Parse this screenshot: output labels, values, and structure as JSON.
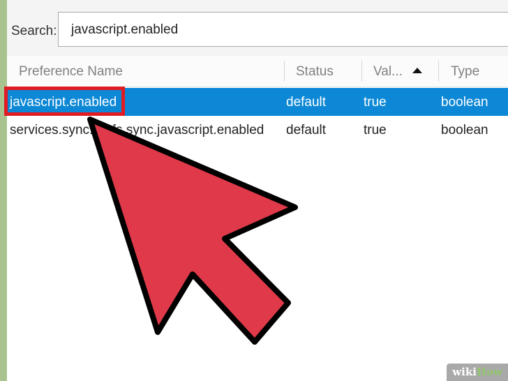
{
  "search": {
    "label": "Search:",
    "value": "javascript.enabled"
  },
  "table": {
    "columns": {
      "name": "Preference Name",
      "status": "Status",
      "value": "Val...",
      "type": "Type"
    },
    "rows": [
      {
        "name": "javascript.enabled",
        "status": "default",
        "value": "true",
        "type": "boolean"
      },
      {
        "name": "services.sync.prefs.sync.javascript.enabled",
        "status": "default",
        "value": "true",
        "type": "boolean"
      }
    ]
  },
  "annotation": {
    "arrow_color": "#e03a4a",
    "box_color": "#e01b24"
  },
  "watermark": {
    "prefix": "wiki",
    "suffix": "How"
  },
  "colors": {
    "selection": "#0d88d6",
    "background": "#a9c38f"
  }
}
